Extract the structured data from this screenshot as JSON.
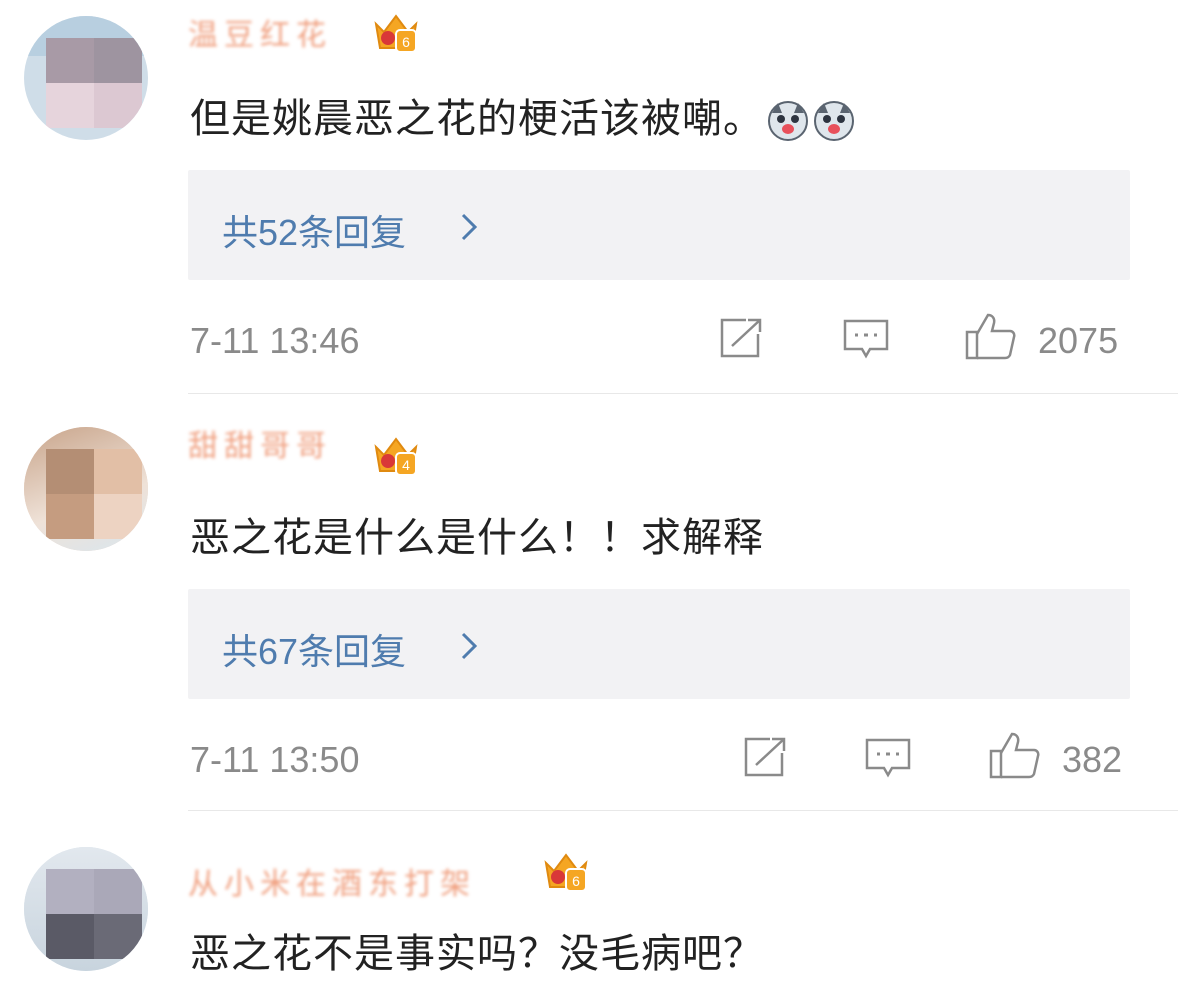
{
  "comments": [
    {
      "username": "温豆红花",
      "level": "6",
      "text": "但是姚晨恶之花的梗活该被嘲。",
      "emoji_icon": "husky-dog-emoji-icon",
      "replies_label": "共52条回复",
      "time": "7-11 13:46",
      "likes": "2075"
    },
    {
      "username": "甜甜哥哥",
      "level": "4",
      "text": "恶之花是什么是什么！！求解释",
      "replies_label": "共67条回复",
      "time": "7-11 13:50",
      "likes": "382"
    },
    {
      "username": "从小米在酒东打架",
      "level": "6",
      "text": "恶之花不是事实吗？没毛病吧？"
    }
  ],
  "icons": {
    "crown": "crown-level-badge-icon",
    "share": "share-icon",
    "comment": "comment-icon",
    "like": "thumbs-up-icon",
    "chevron": "chevron-right-icon"
  },
  "colors": {
    "reply_link": "#4f7cae",
    "meta_text": "#8a8a8a",
    "crown": "#f5a623",
    "reply_box_bg": "#f2f2f4"
  }
}
